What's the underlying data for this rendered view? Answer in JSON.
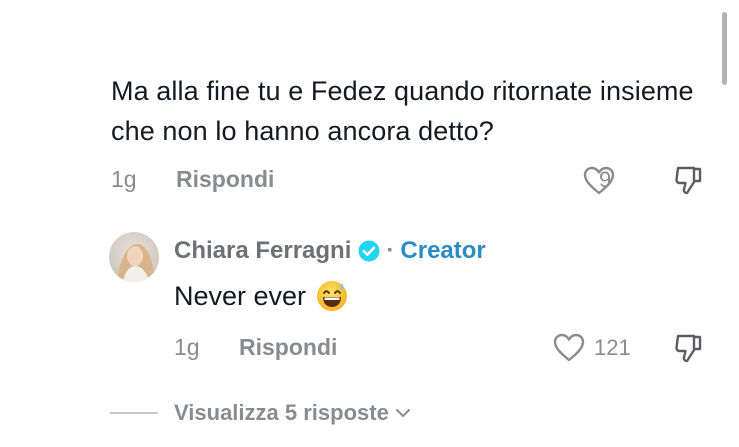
{
  "comment": {
    "text": "Ma alla fine tu e Fedez quando ritornate insieme che non lo hanno ancora detto?",
    "time": "1g",
    "reply_label": "Rispondi",
    "likes": "9",
    "like_icon": "heart-outline-icon",
    "dislike_icon": "thumbs-down-icon"
  },
  "reply": {
    "author": "Chiara Ferragni",
    "separator": "·",
    "badge": "Creator",
    "verified_icon": "verified-check-icon",
    "text": "Never ever",
    "emoji": "grinning-sweat-emoji",
    "time": "1g",
    "reply_label": "Rispondi",
    "likes": "121"
  },
  "view_replies": {
    "label": "Visualizza 5 risposte",
    "icon": "chevron-down-icon"
  },
  "colors": {
    "text": "#161823",
    "muted": "#8a8b91",
    "verified": "#20d5ec",
    "creator": "#2b8cc4"
  }
}
